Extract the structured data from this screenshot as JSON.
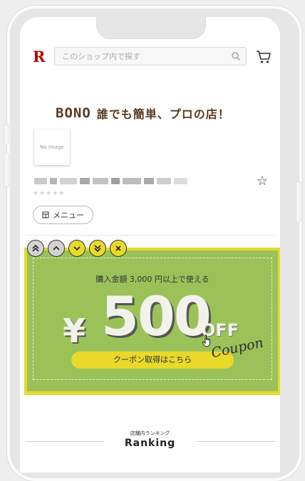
{
  "header": {
    "logo_text": "R",
    "search_placeholder": "このショップ内で探す"
  },
  "shop": {
    "brand_logo": "BONO",
    "brand_tagline": "誰でも簡単、プロの店！",
    "no_image_text": "No Image",
    "rating_stars": "★★★★★",
    "menu_label": "メニュー"
  },
  "coupon": {
    "condition": "購入金額 3,000 円以上で使える",
    "currency": "¥",
    "amount": "500",
    "off_label": "OFF",
    "script_label": "Coupon",
    "button_label": "クーポン取得はこちら"
  },
  "ranking": {
    "subtitle": "店舗内ランキング",
    "title": "Ranking"
  },
  "colors": {
    "rakuten_red": "#bf0000",
    "coupon_green": "#9ac259",
    "coupon_yellow": "#e8d92a",
    "brand_brown": "#5a3a1e"
  },
  "icons": [
    "search-icon",
    "cart-icon",
    "star-outline-icon",
    "shop-menu-icon",
    "double-chevron-up-icon",
    "chevron-up-icon",
    "chevron-down-icon",
    "double-chevron-down-icon",
    "close-icon",
    "hand-cursor-icon"
  ]
}
